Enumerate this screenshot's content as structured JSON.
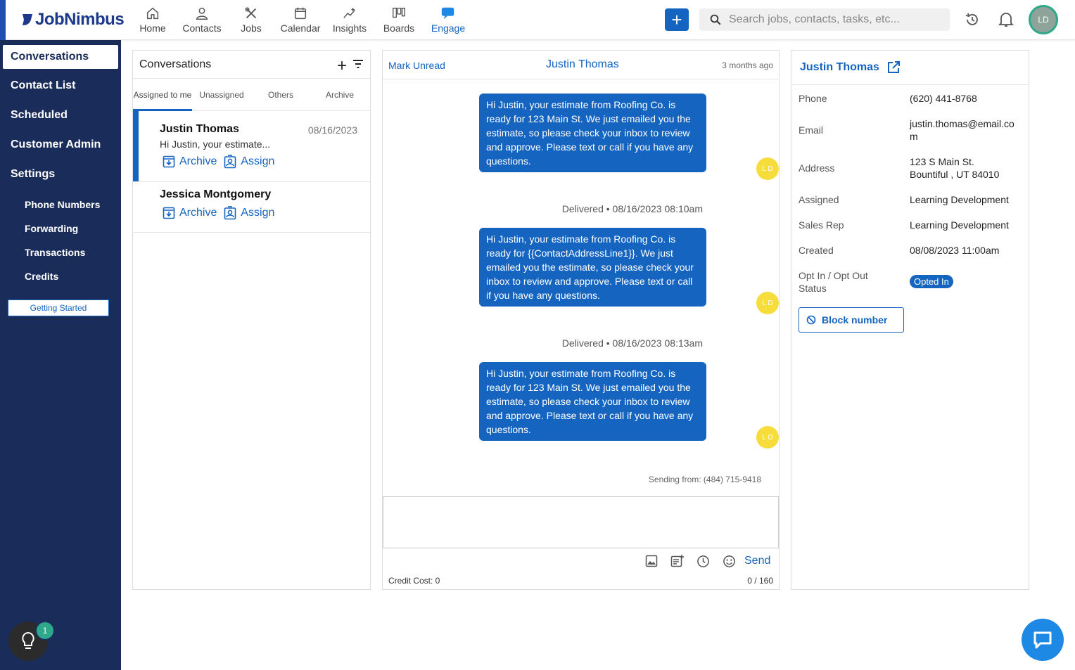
{
  "brand": {
    "name": "JobNimbus"
  },
  "nav": {
    "items": [
      {
        "label": "Home",
        "icon": "home-icon"
      },
      {
        "label": "Contacts",
        "icon": "person-icon"
      },
      {
        "label": "Jobs",
        "icon": "tools-icon"
      },
      {
        "label": "Calendar",
        "icon": "calendar-icon"
      },
      {
        "label": "Insights",
        "icon": "insights-icon"
      },
      {
        "label": "Boards",
        "icon": "boards-icon"
      },
      {
        "label": "Engage",
        "icon": "chat-icon"
      }
    ],
    "active": "Engage"
  },
  "search": {
    "placeholder": "Search jobs, contacts, tasks, etc..."
  },
  "user": {
    "initials": "LD"
  },
  "sidebar": {
    "items": [
      {
        "label": "Conversations"
      },
      {
        "label": "Contact List"
      },
      {
        "label": "Scheduled"
      },
      {
        "label": "Customer Admin"
      },
      {
        "label": "Settings"
      }
    ],
    "subitems": [
      {
        "label": "Phone Numbers"
      },
      {
        "label": "Forwarding"
      },
      {
        "label": "Transactions"
      },
      {
        "label": "Credits"
      }
    ],
    "getting_started": "Getting Started",
    "help_badge": "1"
  },
  "conversations": {
    "title": "Conversations",
    "tabs": [
      "Assigned to me",
      "Unassigned",
      "Others",
      "Archive"
    ],
    "list": [
      {
        "name": "Justin Thomas",
        "date": "08/16/2023",
        "preview": "Hi Justin, your estimate...",
        "archive": "Archive",
        "assign": "Assign"
      },
      {
        "name": "Jessica Montgomery",
        "archive": "Archive",
        "assign": "Assign"
      }
    ]
  },
  "chat": {
    "mark_unread": "Mark Unread",
    "contact_name": "Justin Thomas",
    "time_ago": "3 months ago",
    "messages": [
      {
        "text": "Hi Justin, your estimate from Roofing Co. is ready for 123 Main St. We just emailed you the estimate, so please check your inbox to review and approve. Please text or call if you have any questions.",
        "avatar": "L D"
      },
      {
        "status": "Delivered • 08/16/2023 08:10am"
      },
      {
        "text": "Hi Justin, your estimate from Roofing Co. is ready for {{ContactAddressLine1}}. We just emailed you the estimate, so please check your inbox to review and approve. Please text or call if you have any questions.",
        "avatar": "L D"
      },
      {
        "status": "Delivered • 08/16/2023 08:13am"
      },
      {
        "text": "Hi Justin, your estimate from Roofing Co. is ready for 123 Main St. We just emailed you the estimate, so please check your inbox to review and approve. Please text or call if you have any questions.",
        "avatar": "L D"
      }
    ],
    "sending_from": "Sending from: (484) 715-9418",
    "send_label": "Send",
    "credit_cost": "Credit Cost: 0",
    "char_count": "0  /  160"
  },
  "contact": {
    "name": "Justin Thomas",
    "fields": [
      {
        "label": "Phone",
        "value": "(620) 441-8768"
      },
      {
        "label": "Email",
        "value": "justin.thomas@email.com"
      },
      {
        "label": "Address",
        "value": "123 S Main St. Bountiful , UT 84010"
      },
      {
        "label": "Assigned",
        "value": "Learning Development"
      },
      {
        "label": "Sales Rep",
        "value": "Learning Development"
      },
      {
        "label": "Created",
        "value": "08/08/2023 11:00am"
      },
      {
        "label": "Opt In / Opt Out Status",
        "value": "Opted In"
      }
    ],
    "block_label": "Block number"
  },
  "colors": {
    "primary": "#1565c0",
    "sidebar": "#1a2d5a",
    "avatar_dot": "#f7dd3b",
    "accent_green": "#2ea88a"
  }
}
